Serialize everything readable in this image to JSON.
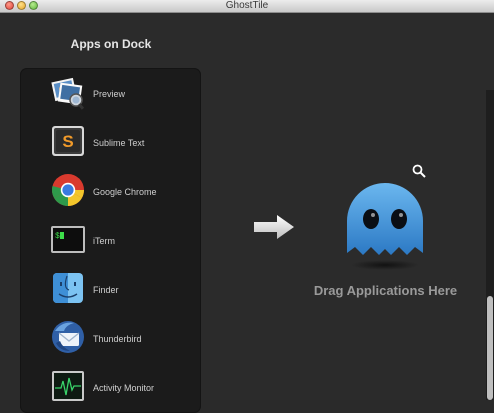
{
  "window": {
    "title": "GhostTile"
  },
  "dock": {
    "heading": "Apps on Dock",
    "apps": [
      {
        "label": "Preview",
        "icon": "preview-icon"
      },
      {
        "label": "Sublime Text",
        "icon": "sublime-text-icon"
      },
      {
        "label": "Google Chrome",
        "icon": "chrome-icon"
      },
      {
        "label": "iTerm",
        "icon": "iterm-icon"
      },
      {
        "label": "Finder",
        "icon": "finder-icon"
      },
      {
        "label": "Thunderbird",
        "icon": "thunderbird-icon"
      },
      {
        "label": "Activity Monitor",
        "icon": "activity-monitor-icon"
      }
    ]
  },
  "drop_zone": {
    "label": "Drag Applications Here",
    "icon": "ghost-icon",
    "arrow_icon": "arrow-right-icon",
    "search_icon": "magnifier-icon"
  },
  "colors": {
    "background": "#2a2a2a",
    "panel": "#1b1b1b",
    "ghost": "#3f8fd6",
    "label": "#9a9a9a"
  }
}
